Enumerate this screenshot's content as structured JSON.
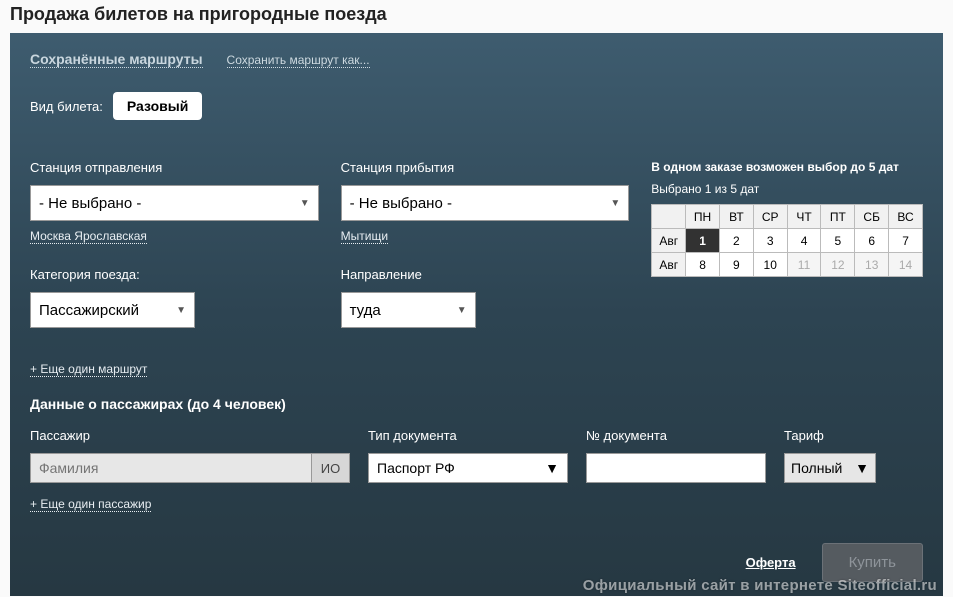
{
  "page": {
    "title": "Продажа билетов на пригородные поезда"
  },
  "top": {
    "saved_routes": "Сохранённые маршруты",
    "save_as": "Сохранить маршрут как..."
  },
  "ticket": {
    "type_label": "Вид билета:",
    "type_value": "Разовый"
  },
  "departure": {
    "label": "Станция отправления",
    "value": "- Не выбрано -",
    "suggestion": "Москва Ярославская"
  },
  "arrival": {
    "label": "Станция прибытия",
    "value": "- Не выбрано -",
    "suggestion": "Мытищи"
  },
  "category": {
    "label": "Категория поезда:",
    "value": "Пассажирский"
  },
  "direction": {
    "label": "Направление",
    "value": "туда"
  },
  "calendar": {
    "hint": "В одном заказе возможен выбор до 5 дат",
    "selected_text": "Выбрано 1 из 5 дат",
    "days": [
      "ПН",
      "ВТ",
      "СР",
      "ЧТ",
      "ПТ",
      "СБ",
      "ВС"
    ],
    "rows": [
      {
        "month": "Авг",
        "cells": [
          {
            "v": "1",
            "sel": true
          },
          {
            "v": "2"
          },
          {
            "v": "3"
          },
          {
            "v": "4"
          },
          {
            "v": "5"
          },
          {
            "v": "6"
          },
          {
            "v": "7"
          }
        ]
      },
      {
        "month": "Авг",
        "cells": [
          {
            "v": "8"
          },
          {
            "v": "9"
          },
          {
            "v": "10"
          },
          {
            "v": "11",
            "dis": true
          },
          {
            "v": "12",
            "dis": true
          },
          {
            "v": "13",
            "dis": true
          },
          {
            "v": "14",
            "dis": true
          }
        ]
      }
    ]
  },
  "add_route": "+ Еще один маршрут",
  "passengers": {
    "title": "Данные о пассажирах (до 4 человек)",
    "name_label": "Пассажир",
    "surname_placeholder": "Фамилия",
    "io": "ИО",
    "doc_type_label": "Тип документа",
    "doc_type_value": "Паспорт РФ",
    "doc_num_label": "№ документа",
    "tarif_label": "Тариф",
    "tarif_value": "Полный",
    "add": "+ Еще один пассажир"
  },
  "footer": {
    "offer": "Оферта",
    "buy": "Купить"
  },
  "watermark": "Официальный сайт в интернете Siteofficial.ru"
}
